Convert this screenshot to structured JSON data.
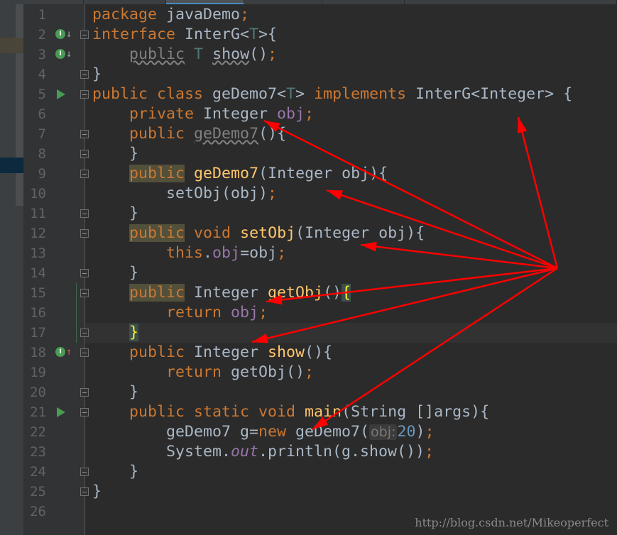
{
  "editor": {
    "tabs": [
      "",
      "",
      "",
      "",
      "",
      ""
    ],
    "active_tab": 2,
    "current_line": 17,
    "lines": [
      [
        [
          "package",
          "k"
        ],
        [
          " javaDemo",
          "t"
        ],
        [
          ";",
          "p"
        ]
      ],
      [
        [
          "interface",
          "k"
        ],
        [
          " InterG<",
          "t"
        ],
        [
          "T",
          "tp"
        ],
        [
          ">{",
          "t"
        ]
      ],
      [
        [
          "    ",
          ""
        ],
        [
          "public",
          "dim"
        ],
        [
          " ",
          ""
        ],
        [
          "T",
          "tp"
        ],
        [
          " ",
          ""
        ],
        [
          "show",
          "wavy"
        ],
        [
          "()",
          "t"
        ],
        [
          ";",
          "p"
        ]
      ],
      [
        [
          "}",
          "t"
        ]
      ],
      [
        [
          "public class",
          "k"
        ],
        [
          " geDemo7<",
          "t"
        ],
        [
          "T",
          "tp"
        ],
        [
          "> ",
          "t"
        ],
        [
          "implements",
          "k"
        ],
        [
          " InterG<Integer> {",
          "t"
        ]
      ],
      [
        [
          "    ",
          ""
        ],
        [
          "private",
          "k"
        ],
        [
          " Integer ",
          "t"
        ],
        [
          "obj",
          "f"
        ],
        [
          ";",
          "p"
        ]
      ],
      [
        [
          "    ",
          ""
        ],
        [
          "public",
          "k"
        ],
        [
          " ",
          ""
        ],
        [
          "geDemo7",
          "dimm"
        ],
        [
          "(){",
          "t"
        ]
      ],
      [
        [
          "    ",
          ""
        ],
        [
          "}",
          "t"
        ]
      ],
      [
        [
          "    ",
          ""
        ],
        [
          "public",
          "hlk"
        ],
        [
          " ",
          ""
        ],
        [
          "geDemo7",
          "m"
        ],
        [
          "(Integer obj){",
          "t"
        ]
      ],
      [
        [
          "        ",
          ""
        ],
        [
          "setObj(obj)",
          "t"
        ],
        [
          ";",
          "p"
        ]
      ],
      [
        [
          "    ",
          ""
        ],
        [
          "}",
          "t"
        ]
      ],
      [
        [
          "    ",
          ""
        ],
        [
          "public",
          "hlk"
        ],
        [
          " ",
          ""
        ],
        [
          "void",
          "k"
        ],
        [
          " ",
          ""
        ],
        [
          "setObj",
          "m"
        ],
        [
          "(Integer obj){",
          "t"
        ]
      ],
      [
        [
          "        ",
          ""
        ],
        [
          "this",
          "k"
        ],
        [
          ".",
          "t"
        ],
        [
          "obj",
          "f"
        ],
        [
          "=obj",
          "t"
        ],
        [
          ";",
          "p"
        ]
      ],
      [
        [
          "    ",
          ""
        ],
        [
          "}",
          "t"
        ]
      ],
      [
        [
          "    ",
          ""
        ],
        [
          "public",
          "hlk"
        ],
        [
          " Integer ",
          "t"
        ],
        [
          "getObj",
          "m"
        ],
        [
          "()",
          "t"
        ],
        [
          "{",
          "brace"
        ]
      ],
      [
        [
          "        ",
          ""
        ],
        [
          "return",
          "k"
        ],
        [
          " ",
          ""
        ],
        [
          "obj",
          "f"
        ],
        [
          ";",
          "p"
        ]
      ],
      [
        [
          "    ",
          ""
        ],
        [
          "}",
          "brace"
        ]
      ],
      [
        [
          "    ",
          ""
        ],
        [
          "public",
          "k"
        ],
        [
          " Integer ",
          "t"
        ],
        [
          "show",
          "m"
        ],
        [
          "(){",
          "t"
        ]
      ],
      [
        [
          "        ",
          ""
        ],
        [
          "return",
          "k"
        ],
        [
          " getObj()",
          "t"
        ],
        [
          ";",
          "p"
        ]
      ],
      [
        [
          "    ",
          ""
        ],
        [
          "}",
          "t"
        ]
      ],
      [
        [
          "    ",
          ""
        ],
        [
          "public static void",
          "k"
        ],
        [
          " ",
          ""
        ],
        [
          "main",
          "m"
        ],
        [
          "(String []args){",
          "t"
        ]
      ],
      [
        [
          "        ",
          ""
        ],
        [
          "geDemo7 g=",
          "t"
        ],
        [
          "new",
          "k"
        ],
        [
          " geDemo7(",
          "t"
        ],
        [
          "obj:",
          "hint"
        ],
        [
          "20",
          "n"
        ],
        [
          ")",
          "t"
        ],
        [
          ";",
          "p"
        ]
      ],
      [
        [
          "        ",
          ""
        ],
        [
          "System.",
          "t"
        ],
        [
          "out",
          "i"
        ],
        [
          ".println(g.show())",
          "t"
        ],
        [
          ";",
          "p"
        ]
      ],
      [
        [
          "    ",
          ""
        ],
        [
          "}",
          "t"
        ]
      ],
      [
        [
          "}",
          "t"
        ]
      ],
      []
    ],
    "gutter_markers": [
      {
        "line": 2,
        "icon": "implemented-interface-icon",
        "letter": "I",
        "arrow": "↓",
        "arrow_color": "#a0a0a0"
      },
      {
        "line": 3,
        "icon": "implemented-method-icon",
        "letter": "I",
        "arrow": "↓",
        "arrow_color": "#a0a0a0"
      },
      {
        "line": 18,
        "icon": "implements-method-icon",
        "letter": "I",
        "arrow": "↑",
        "arrow_color": "#e05555"
      },
      {
        "line": 5,
        "icon": "run-icon"
      },
      {
        "line": 21,
        "icon": "run-icon"
      }
    ],
    "fold_lines": [
      2,
      4,
      5,
      7,
      8,
      9,
      11,
      12,
      14,
      15,
      17,
      18,
      20,
      21,
      24,
      25
    ]
  },
  "annotation_color": "#ff0000",
  "watermark": "http://blog.csdn.net/Mikeoperfect"
}
